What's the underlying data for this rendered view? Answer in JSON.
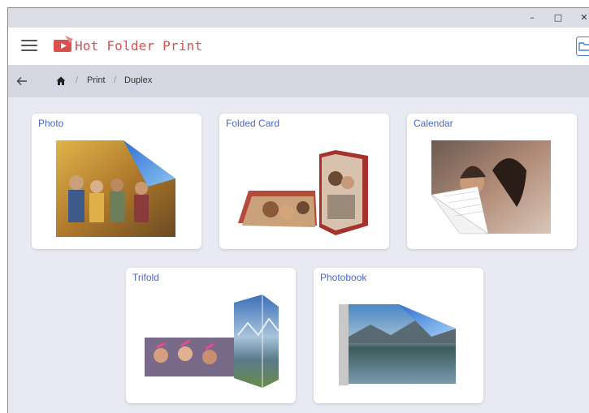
{
  "window": {
    "minimize_glyph": "–",
    "maximize_glyph": "□",
    "close_glyph": "✕"
  },
  "appbar": {
    "title": "Hot Folder Print",
    "brand_color": "#d9514e"
  },
  "breadcrumb": {
    "items": [
      "Print",
      "Duplex"
    ],
    "separator": "/"
  },
  "cards": [
    {
      "title": "Photo",
      "icon": "photo-print-image"
    },
    {
      "title": "Folded Card",
      "icon": "folded-card-image"
    },
    {
      "title": "Calendar",
      "icon": "calendar-image"
    },
    {
      "title": "Trifold",
      "icon": "trifold-image"
    },
    {
      "title": "Photobook",
      "icon": "photobook-image"
    }
  ],
  "colors": {
    "background": "#e8e9f2",
    "breadcrumb_bar": "#d4d6e1",
    "card_title": "#4a67c9",
    "folder_button": "#4a7fd6"
  }
}
